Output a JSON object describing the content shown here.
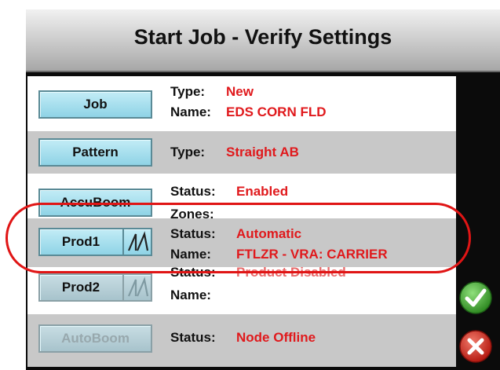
{
  "screen": {
    "title": "Start Job - Verify Settings"
  },
  "rows": [
    {
      "button": "Job",
      "lines": [
        {
          "label": "Type:",
          "value": "New"
        },
        {
          "label": "Name:",
          "value": "EDS CORN FLD"
        }
      ]
    },
    {
      "button": "Pattern",
      "lines": [
        {
          "label": "Type:",
          "value": "Straight AB"
        }
      ]
    },
    {
      "button": "AccuBoom",
      "lines": [
        {
          "label": "Status:",
          "value": "Enabled"
        },
        {
          "label": "Zones:",
          "value": ""
        }
      ]
    },
    {
      "button": "Prod1",
      "icon": "product-rate-icon",
      "lines": [
        {
          "label": "Status:",
          "value": "Automatic"
        },
        {
          "label": "Name:",
          "value": "FTLZR - VRA: CARRIER"
        }
      ]
    },
    {
      "button": "Prod2",
      "icon": "product-rate-icon",
      "lines": [
        {
          "label": "Status:",
          "value": "Product Disabled"
        },
        {
          "label": "Name:",
          "value": ""
        }
      ]
    },
    {
      "button": "AutoBoom",
      "lines": [
        {
          "label": "Status:",
          "value": "Node Offline"
        }
      ]
    }
  ],
  "actions": {
    "accept_icon": "checkmark-icon",
    "cancel_icon": "close-icon"
  },
  "colors": {
    "value_text": "#e0191c",
    "button_fill": "#8fd3e6",
    "highlight_oval": "#e01515"
  }
}
